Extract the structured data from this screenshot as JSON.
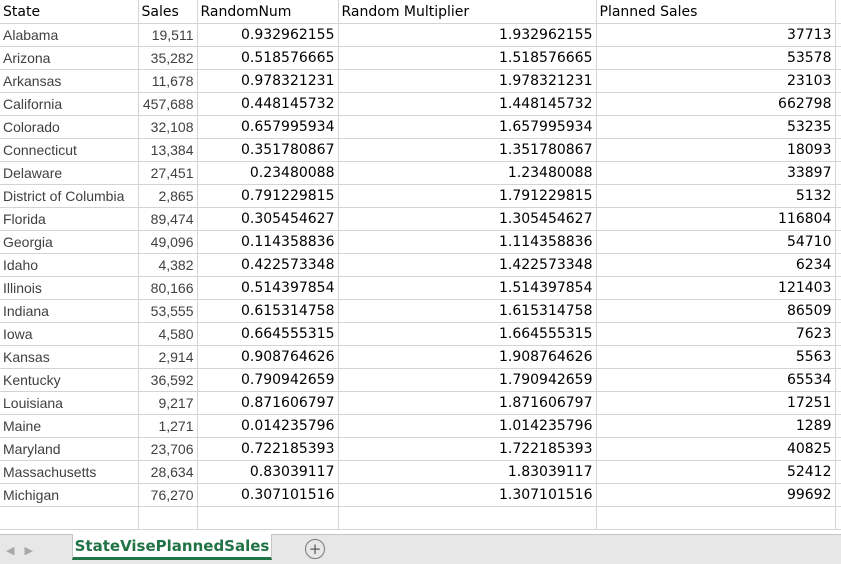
{
  "sheet": {
    "headers": [
      "State",
      "Sales",
      "RandomNum",
      "Random Multiplier",
      "Planned Sales"
    ],
    "rows": [
      [
        "Alabama",
        "19,511",
        "0.932962155",
        "1.932962155",
        "37713"
      ],
      [
        "Arizona",
        "35,282",
        "0.518576665",
        "1.518576665",
        "53578"
      ],
      [
        "Arkansas",
        "11,678",
        "0.978321231",
        "1.978321231",
        "23103"
      ],
      [
        "California",
        "457,688",
        "0.448145732",
        "1.448145732",
        "662798"
      ],
      [
        "Colorado",
        "32,108",
        "0.657995934",
        "1.657995934",
        "53235"
      ],
      [
        "Connecticut",
        "13,384",
        "0.351780867",
        "1.351780867",
        "18093"
      ],
      [
        "Delaware",
        "27,451",
        "0.23480088",
        "1.23480088",
        "33897"
      ],
      [
        "District of Columbia",
        "2,865",
        "0.791229815",
        "1.791229815",
        "5132"
      ],
      [
        "Florida",
        "89,474",
        "0.305454627",
        "1.305454627",
        "116804"
      ],
      [
        "Georgia",
        "49,096",
        "0.114358836",
        "1.114358836",
        "54710"
      ],
      [
        "Idaho",
        "4,382",
        "0.422573348",
        "1.422573348",
        "6234"
      ],
      [
        "Illinois",
        "80,166",
        "0.514397854",
        "1.514397854",
        "121403"
      ],
      [
        "Indiana",
        "53,555",
        "0.615314758",
        "1.615314758",
        "86509"
      ],
      [
        "Iowa",
        "4,580",
        "0.664555315",
        "1.664555315",
        "7623"
      ],
      [
        "Kansas",
        "2,914",
        "0.908764626",
        "1.908764626",
        "5563"
      ],
      [
        "Kentucky",
        "36,592",
        "0.790942659",
        "1.790942659",
        "65534"
      ],
      [
        "Louisiana",
        "9,217",
        "0.871606797",
        "1.871606797",
        "17251"
      ],
      [
        "Maine",
        "1,271",
        "0.014235796",
        "1.014235796",
        "1289"
      ],
      [
        "Maryland",
        "23,706",
        "0.722185393",
        "1.722185393",
        "40825"
      ],
      [
        "Massachusetts",
        "28,634",
        "0.83039117",
        "1.83039117",
        "52412"
      ],
      [
        "Michigan",
        "76,270",
        "0.307101516",
        "1.307101516",
        "99692"
      ]
    ]
  },
  "tabs": {
    "active_label": "StateVisePlannedSales",
    "add_icon": "plus-circle-icon",
    "nav_icons": [
      "scroll-left-icon",
      "scroll-right-icon"
    ]
  },
  "colors": {
    "accent": "#217346",
    "grid_line": "#d4d4d4",
    "tabbar_bg": "#e7e7e7",
    "state_text": "#404040"
  }
}
